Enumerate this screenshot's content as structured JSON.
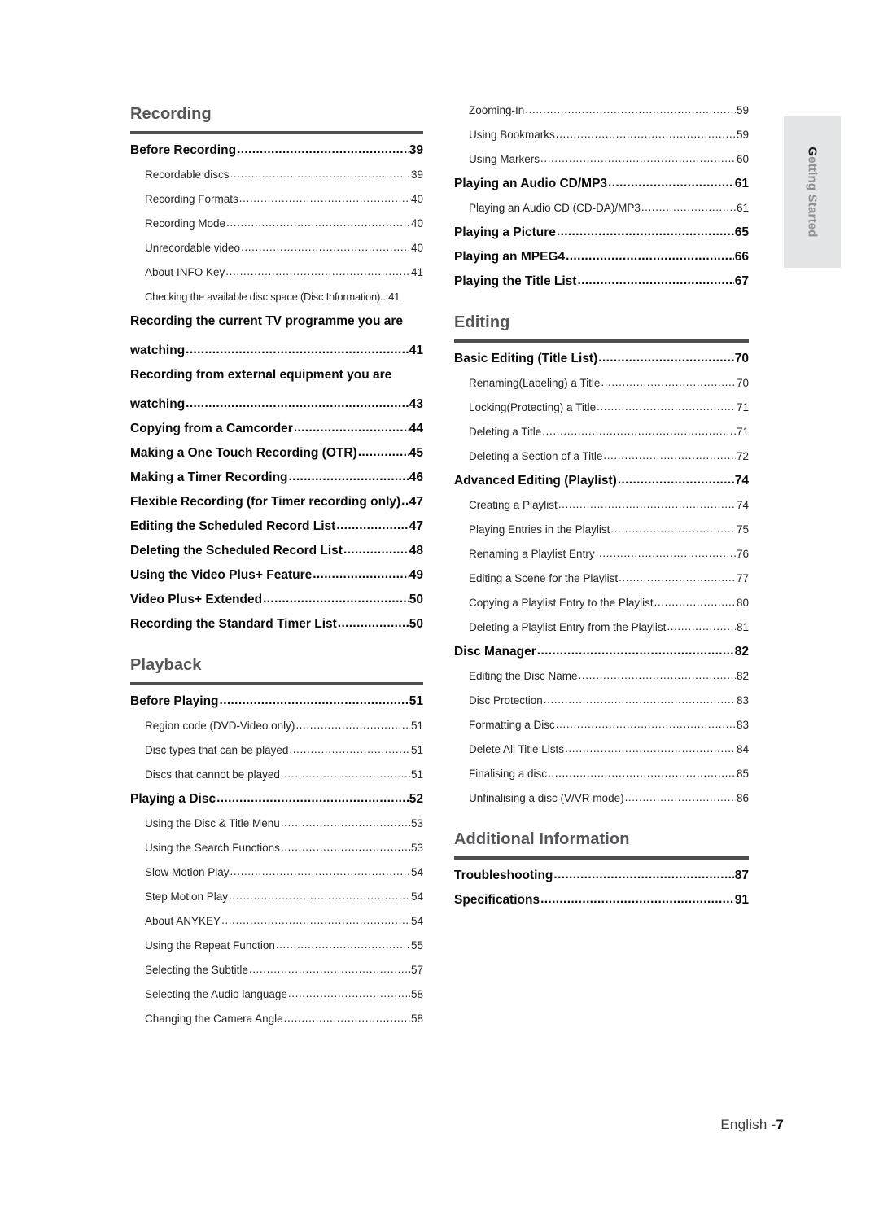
{
  "side_tab": {
    "initial": "G",
    "rest": "etting Started",
    "full": "Getting Started"
  },
  "footer": {
    "language": "English -",
    "page": "7"
  },
  "columns": {
    "left": [
      {
        "id": "recording",
        "title": "Recording",
        "entries": [
          {
            "level": 1,
            "label": "Before Recording",
            "page": "39"
          },
          {
            "level": 2,
            "label": "Recordable discs",
            "page": "39"
          },
          {
            "level": 2,
            "label": "Recording Formats ",
            "page": "40"
          },
          {
            "level": 2,
            "label": "Recording Mode",
            "page": "40"
          },
          {
            "level": 2,
            "label": "Unrecordable video",
            "page": "40"
          },
          {
            "level": 2,
            "label": "About INFO Key",
            "page": "41"
          },
          {
            "level": 2,
            "tight": true,
            "label": "Checking the available disc space (Disc Information)...",
            "page": "41"
          },
          {
            "level": 1,
            "wrap": true,
            "line1": "Recording the current TV programme you are",
            "label": "watching ",
            "page": "41"
          },
          {
            "level": 1,
            "wrap": true,
            "line1": "Recording from external equipment you are",
            "label": "watching ",
            "page": "43"
          },
          {
            "level": 1,
            "label": "Copying from a Camcorder ",
            "page": "44"
          },
          {
            "level": 1,
            "label": "Making a One Touch Recording (OTR)",
            "page": "45"
          },
          {
            "level": 1,
            "label": "Making a Timer Recording",
            "page": "46"
          },
          {
            "level": 1,
            "label": "Flexible Recording (for Timer recording only) ",
            "page": "47"
          },
          {
            "level": 1,
            "label": "Editing the Scheduled Record List",
            "page": "47"
          },
          {
            "level": 1,
            "label": "Deleting the Scheduled Record List",
            "page": "48"
          },
          {
            "level": 1,
            "label": "Using the Video Plus+ Feature ",
            "page": "49"
          },
          {
            "level": 1,
            "label": "Video Plus+ Extended",
            "page": "50"
          },
          {
            "level": 1,
            "label": "Recording the Standard Timer List ",
            "page": "50"
          }
        ]
      },
      {
        "id": "playback",
        "title": "Playback",
        "entries": [
          {
            "level": 1,
            "label": "Before Playing ",
            "page": "51"
          },
          {
            "level": 2,
            "label": "Region code (DVD-Video only)",
            "page": "51"
          },
          {
            "level": 2,
            "label": "Disc types that can be played ",
            "page": "51"
          },
          {
            "level": 2,
            "label": "Discs that cannot be played ",
            "page": "51"
          },
          {
            "level": 1,
            "label": "Playing a Disc",
            "page": "52"
          },
          {
            "level": 2,
            "label": "Using the Disc & Title Menu ",
            "page": "53"
          },
          {
            "level": 2,
            "label": "Using the Search Functions ",
            "page": "53"
          },
          {
            "level": 2,
            "label": "Slow Motion Play",
            "page": "54"
          },
          {
            "level": 2,
            "label": "Step Motion Play ",
            "page": "54"
          },
          {
            "level": 2,
            "label": "About ANYKEY ",
            "page": "54"
          },
          {
            "level": 2,
            "label": "Using the Repeat Function",
            "page": "55"
          },
          {
            "level": 2,
            "label": "Selecting the Subtitle ",
            "page": "57"
          },
          {
            "level": 2,
            "label": "Selecting the Audio language",
            "page": "58"
          },
          {
            "level": 2,
            "label": "Changing the Camera Angle",
            "page": "58"
          }
        ]
      }
    ],
    "right": [
      {
        "id": "playback-continued",
        "title": "",
        "entries": [
          {
            "level": 2,
            "label": "Zooming-In",
            "page": "59"
          },
          {
            "level": 2,
            "label": "Using Bookmarks",
            "page": "59"
          },
          {
            "level": 2,
            "label": "Using Markers ",
            "page": "60"
          },
          {
            "level": 1,
            "label": "Playing an Audio CD/MP3  ",
            "page": "61"
          },
          {
            "level": 2,
            "label": "Playing an Audio CD (CD-DA)/MP3 ",
            "page": "61"
          },
          {
            "level": 1,
            "label": "Playing a Picture ",
            "page": "65"
          },
          {
            "level": 1,
            "label": "Playing an MPEG4 ",
            "page": "66"
          },
          {
            "level": 1,
            "label": "Playing the Title List ",
            "page": "67"
          }
        ]
      },
      {
        "id": "editing",
        "title": "Editing",
        "entries": [
          {
            "level": 1,
            "label": "Basic Editing (Title List) ",
            "page": "70"
          },
          {
            "level": 2,
            "label": "Renaming(Labeling) a Title",
            "page": "70"
          },
          {
            "level": 2,
            "label": "Locking(Protecting) a Title ",
            "page": "71"
          },
          {
            "level": 2,
            "label": "Deleting a Title ",
            "page": "71"
          },
          {
            "level": 2,
            "label": "Deleting a Section of a Title ",
            "page": "72"
          },
          {
            "level": 1,
            "label": "Advanced Editing (Playlist) ",
            "page": "74"
          },
          {
            "level": 2,
            "label": "Creating a Playlist ",
            "page": "74"
          },
          {
            "level": 2,
            "label": "Playing Entries in the Playlist ",
            "page": "75"
          },
          {
            "level": 2,
            "label": "Renaming a Playlist Entry ",
            "page": "76"
          },
          {
            "level": 2,
            "label": "Editing a Scene for the Playlist ",
            "page": "77"
          },
          {
            "level": 2,
            "label": "Copying a Playlist Entry to the Playlist ",
            "page": "80"
          },
          {
            "level": 2,
            "label": "Deleting a Playlist Entry from the Playlist",
            "page": "81"
          },
          {
            "level": 1,
            "label": "Disc Manager ",
            "page": "82"
          },
          {
            "level": 2,
            "label": "Editing the Disc Name ",
            "page": "82"
          },
          {
            "level": 2,
            "label": "Disc Protection ",
            "page": "83"
          },
          {
            "level": 2,
            "label": "Formatting a Disc",
            "page": "83"
          },
          {
            "level": 2,
            "label": "Delete All Title Lists ",
            "page": "84"
          },
          {
            "level": 2,
            "label": "Finalising a disc",
            "page": "85"
          },
          {
            "level": 2,
            "label": "Unfinalising a disc (V/VR mode) ",
            "page": "86"
          }
        ]
      },
      {
        "id": "additional-information",
        "title": "Additional Information",
        "entries": [
          {
            "level": 1,
            "label": "Troubleshooting",
            "page": "87"
          },
          {
            "level": 1,
            "label": "Specifications ",
            "page": "91"
          }
        ]
      }
    ]
  }
}
